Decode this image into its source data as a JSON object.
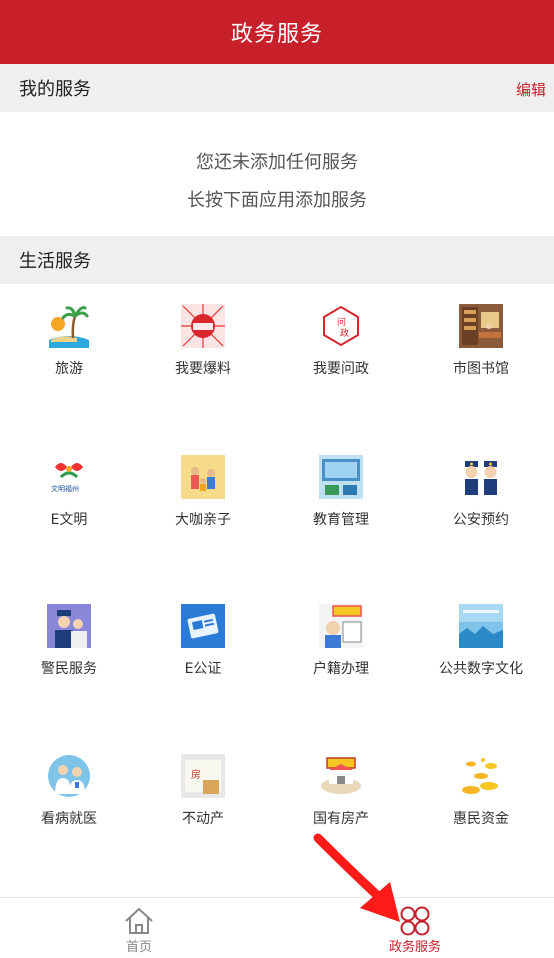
{
  "header": {
    "title": "政务服务"
  },
  "my_services": {
    "title": "我的服务",
    "edit_label": "编辑",
    "empty_line1": "您还未添加任何服务",
    "empty_line2": "长按下面应用添加服务"
  },
  "life_services": {
    "title": "生活服务",
    "items": [
      {
        "label": "旅游",
        "icon": "palm-tree-icon"
      },
      {
        "label": "我要爆料",
        "icon": "news-tip-icon"
      },
      {
        "label": "我要问政",
        "icon": "ask-government-icon"
      },
      {
        "label": "市图书馆",
        "icon": "library-icon"
      },
      {
        "label": "E文明",
        "icon": "civilization-logo-icon"
      },
      {
        "label": "大咖亲子",
        "icon": "parent-child-icon"
      },
      {
        "label": "教育管理",
        "icon": "education-icon"
      },
      {
        "label": "公安预约",
        "icon": "police-appointment-icon"
      },
      {
        "label": "警民服务",
        "icon": "police-service-icon"
      },
      {
        "label": "E公证",
        "icon": "notary-icon"
      },
      {
        "label": "户籍办理",
        "icon": "household-register-icon"
      },
      {
        "label": "公共数字文化",
        "icon": "digital-culture-icon"
      },
      {
        "label": "看病就医",
        "icon": "doctor-icon"
      },
      {
        "label": "不动产",
        "icon": "real-estate-icon"
      },
      {
        "label": "国有房产",
        "icon": "state-property-icon"
      },
      {
        "label": "惠民资金",
        "icon": "coins-icon"
      }
    ]
  },
  "tabbar": {
    "home_label": "首页",
    "gov_label": "政务服务",
    "active_color": "#c8202a",
    "inactive_color": "#888888"
  }
}
